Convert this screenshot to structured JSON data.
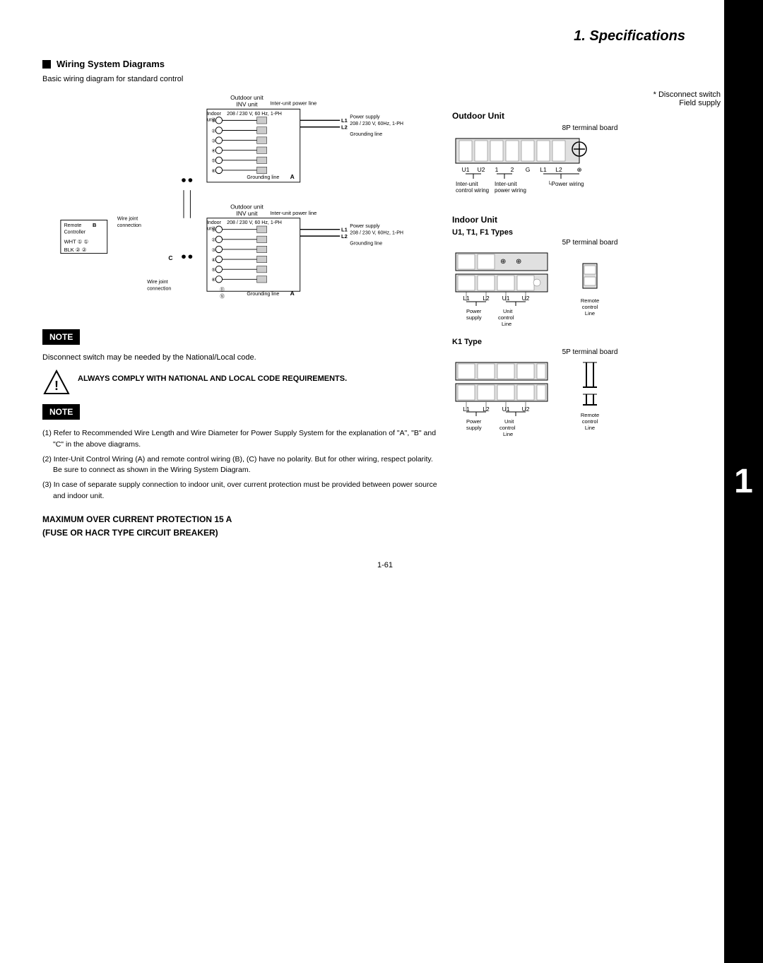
{
  "page": {
    "title": "1. Specifications",
    "number": "1-61"
  },
  "sidebar": {
    "number": "1"
  },
  "wiring_section": {
    "header": "Wiring System Diagrams",
    "basic_text": "Basic wiring diagram for standard control"
  },
  "disconnect_note": {
    "line1": "* Disconnect switch",
    "line2": "Field supply"
  },
  "notes": {
    "note_label": "NOTE",
    "note1_text": "Disconnect switch may be needed by the National/Local code.",
    "warning_text": "ALWAYS COMPLY WITH NATIONAL AND LOCAL CODE REQUIREMENTS.",
    "note2_items": [
      "(1) Refer to Recommended Wire Length and Wire Diameter for Power Supply System for the explanation of \"A\", \"B\" and \"C\" in the above diagrams.",
      "(2) Inter-Unit Control Wiring (A) and remote control wiring (B), (C) have no polarity. But for other wiring, respect polarity. Be sure to connect as shown in the Wiring System Diagram.",
      "(3) In case of separate supply connection to indoor unit, over current protection must be provided between power source and indoor unit."
    ]
  },
  "max_protection": {
    "line1": "MAXIMUM OVER CURRENT PROTECTION 15 A",
    "line2": "(FUSE OR HACR TYPE CIRCUIT BREAKER)"
  },
  "outdoor_unit": {
    "title": "Outdoor Unit",
    "terminal_label": "8P terminal board",
    "terminals": "U1 U2 1  2  G  L1 L2 ⊕",
    "inter_unit_control": "Inter-unit",
    "control_wiring": "control wiring",
    "inter_unit_power": "Inter-unit",
    "power_wiring": "power wiring",
    "power_wiring_label": "└Power wiring"
  },
  "indoor_unit": {
    "title": "Indoor Unit",
    "u1t1f1": {
      "type_label": "U1, T1, F1 Types",
      "terminal_label": "5P terminal board",
      "terminals_top": "L1 L2  U1 U2",
      "power_supply": "Power\nsupply",
      "unit_control": "Unit\ncontrol\nLine",
      "remote_control": "Remote\ncontrol\nLine"
    },
    "k1": {
      "type_label": "K1 Type",
      "terminal_label": "5P terminal board",
      "terminals": "L1 L2   U1 U2",
      "power_supply": "Power\nsupply",
      "unit_control": "Unit\ncontrol\nLine",
      "remote_control": "Remote\ncontrol\nLine"
    }
  },
  "wiring_diagram": {
    "outdoor_unit_label": "Outdoor unit",
    "inv_unit_label": "INV unit",
    "inter_unit_power_line": "Inter-unit power line",
    "indoor_unit": "Indoor\nunit",
    "voltage": "208 / 230 V, 60 Hz, 1-PH",
    "wire_joint": "Wire joint\nconnection",
    "grounding_line": "Grounding line",
    "remote_controller": "Remote\nController",
    "wht": "WHT",
    "blk": "BLK",
    "power_supply_label": "Power supply\n208 / 230 V, 60Hz, 1-PH",
    "l1": "L1",
    "l2": "L2",
    "a_label": "A",
    "b_label": "B",
    "c_label": "C"
  }
}
